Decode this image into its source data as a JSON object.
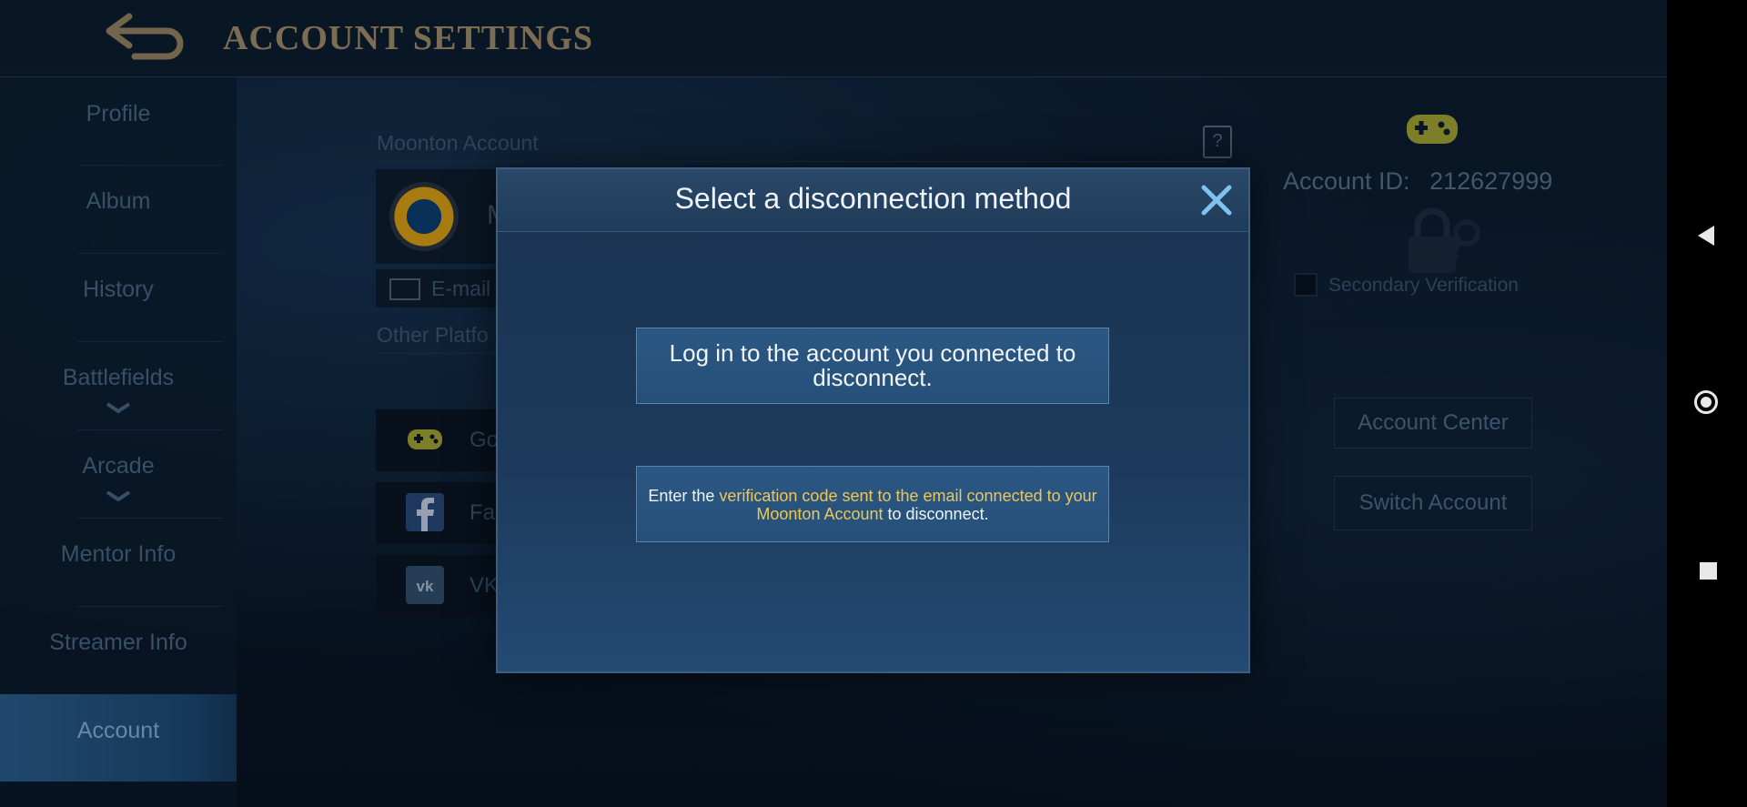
{
  "header": {
    "title": "ACCOUNT SETTINGS"
  },
  "sidebar": {
    "items": [
      {
        "label": "Profile"
      },
      {
        "label": "Album"
      },
      {
        "label": "History"
      },
      {
        "label": "Battlefields",
        "chevron": "⌄"
      },
      {
        "label": "Arcade",
        "chevron": "⌄"
      },
      {
        "label": "Mentor Info"
      },
      {
        "label": "Streamer Info"
      },
      {
        "label": "Account"
      }
    ],
    "active": "Account"
  },
  "background": {
    "moonton_label": "Moonton Account",
    "account_initial": "M",
    "email_label": "E-mail",
    "other_platforms_label": "Other Platfo",
    "platforms": [
      {
        "label": "Go",
        "icon": "gamepad-icon"
      },
      {
        "label": "Fa",
        "icon": "facebook-icon"
      },
      {
        "label": "VK",
        "icon": "vk-icon"
      }
    ],
    "account_id_label": "Account ID:",
    "account_id_value": "212627999",
    "secondary_verification_label": "Secondary Verification",
    "account_center_label": "Account Center",
    "switch_account_label": "Switch Account"
  },
  "modal": {
    "title": "Select a disconnection method",
    "option1": "Log in to the account you connected to disconnect.",
    "option2": {
      "prefix": "Enter the ",
      "highlight": "verification code sent to the email connected to your Moonton Account",
      "suffix": " to disconnect."
    }
  },
  "colors": {
    "title_gold": "#a48f6b",
    "highlight_yellow": "#f0c657",
    "modal_bg": "#1d3a5c"
  }
}
